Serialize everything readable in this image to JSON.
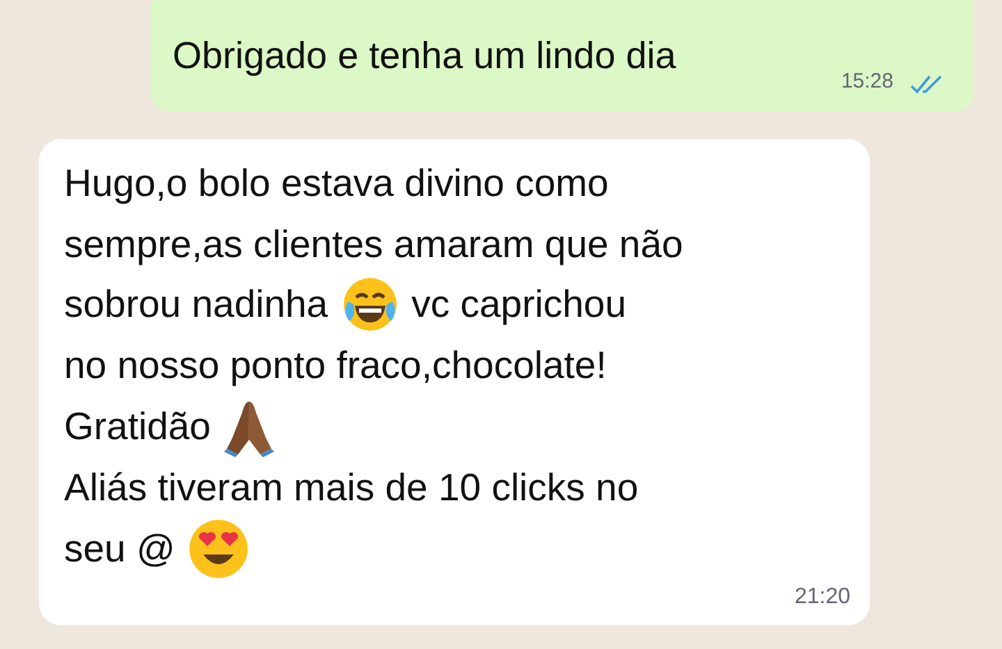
{
  "outgoing": {
    "text": "Obrigado e tenha um lindo dia",
    "time": "15:28",
    "read": true
  },
  "incoming": {
    "lines": [
      [
        {
          "kind": "text",
          "text": "Hugo,o bolo estava divino como"
        }
      ],
      [
        {
          "kind": "text",
          "text": "sempre,as clientes amaram que não"
        }
      ],
      [
        {
          "kind": "text",
          "text": "sobrou nadinha"
        },
        {
          "kind": "laughing"
        },
        {
          "kind": "text",
          "text": "vc caprichou"
        }
      ],
      [
        {
          "kind": "text",
          "text": "no nosso ponto fraco,chocolate!"
        }
      ],
      [
        {
          "kind": "text",
          "text": "Gratidão"
        },
        {
          "kind": "praying"
        }
      ],
      [
        {
          "kind": "text",
          "text": "Aliás tiveram mais de 10 clicks no"
        }
      ],
      [
        {
          "kind": "text",
          "text": "seu @"
        },
        {
          "kind": "heart_eyes"
        }
      ]
    ],
    "time": "21:20"
  }
}
